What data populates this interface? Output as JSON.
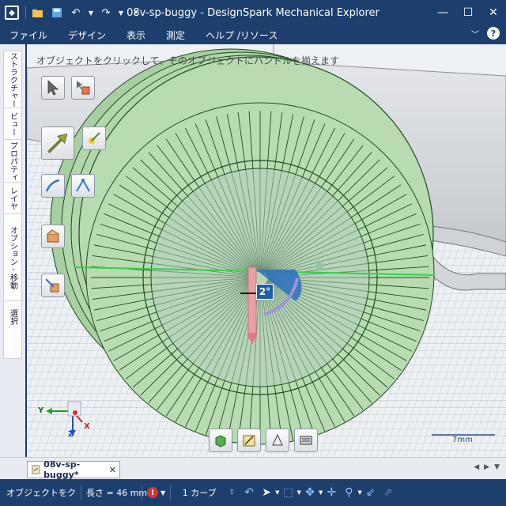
{
  "window": {
    "title": "08v-sp-buggy - DesignSpark Mechanical Explorer"
  },
  "menu": {
    "items": [
      "ファイル",
      "デザイン",
      "表示",
      "測定",
      "ヘルプ /リソース"
    ]
  },
  "left_tabs": [
    "ストラクチャー",
    "ビュー",
    "プロパティ",
    "レイヤ",
    "オプション - 移動",
    "選択"
  ],
  "viewport": {
    "hint": "オブジェクトをクリックして、そのオブジェクトにハンドルを揃えます",
    "dimension_label": "2°",
    "scale_label": "7mm",
    "axis_labels": {
      "y": "Y",
      "z": "Z",
      "x": "X"
    }
  },
  "doc_tab": {
    "label": "08v-sp-buggy*",
    "close": "✕"
  },
  "status": {
    "hint": "オブジェクトをクリッ:",
    "length": "長さ = 46 mm",
    "selection": "1 カーブ"
  },
  "colors": {
    "chrome": "#1d3f6e",
    "wheel_face": "#b3d7ad",
    "wheel_line": "#1f4a1f",
    "grid": "#9fa8b8"
  }
}
